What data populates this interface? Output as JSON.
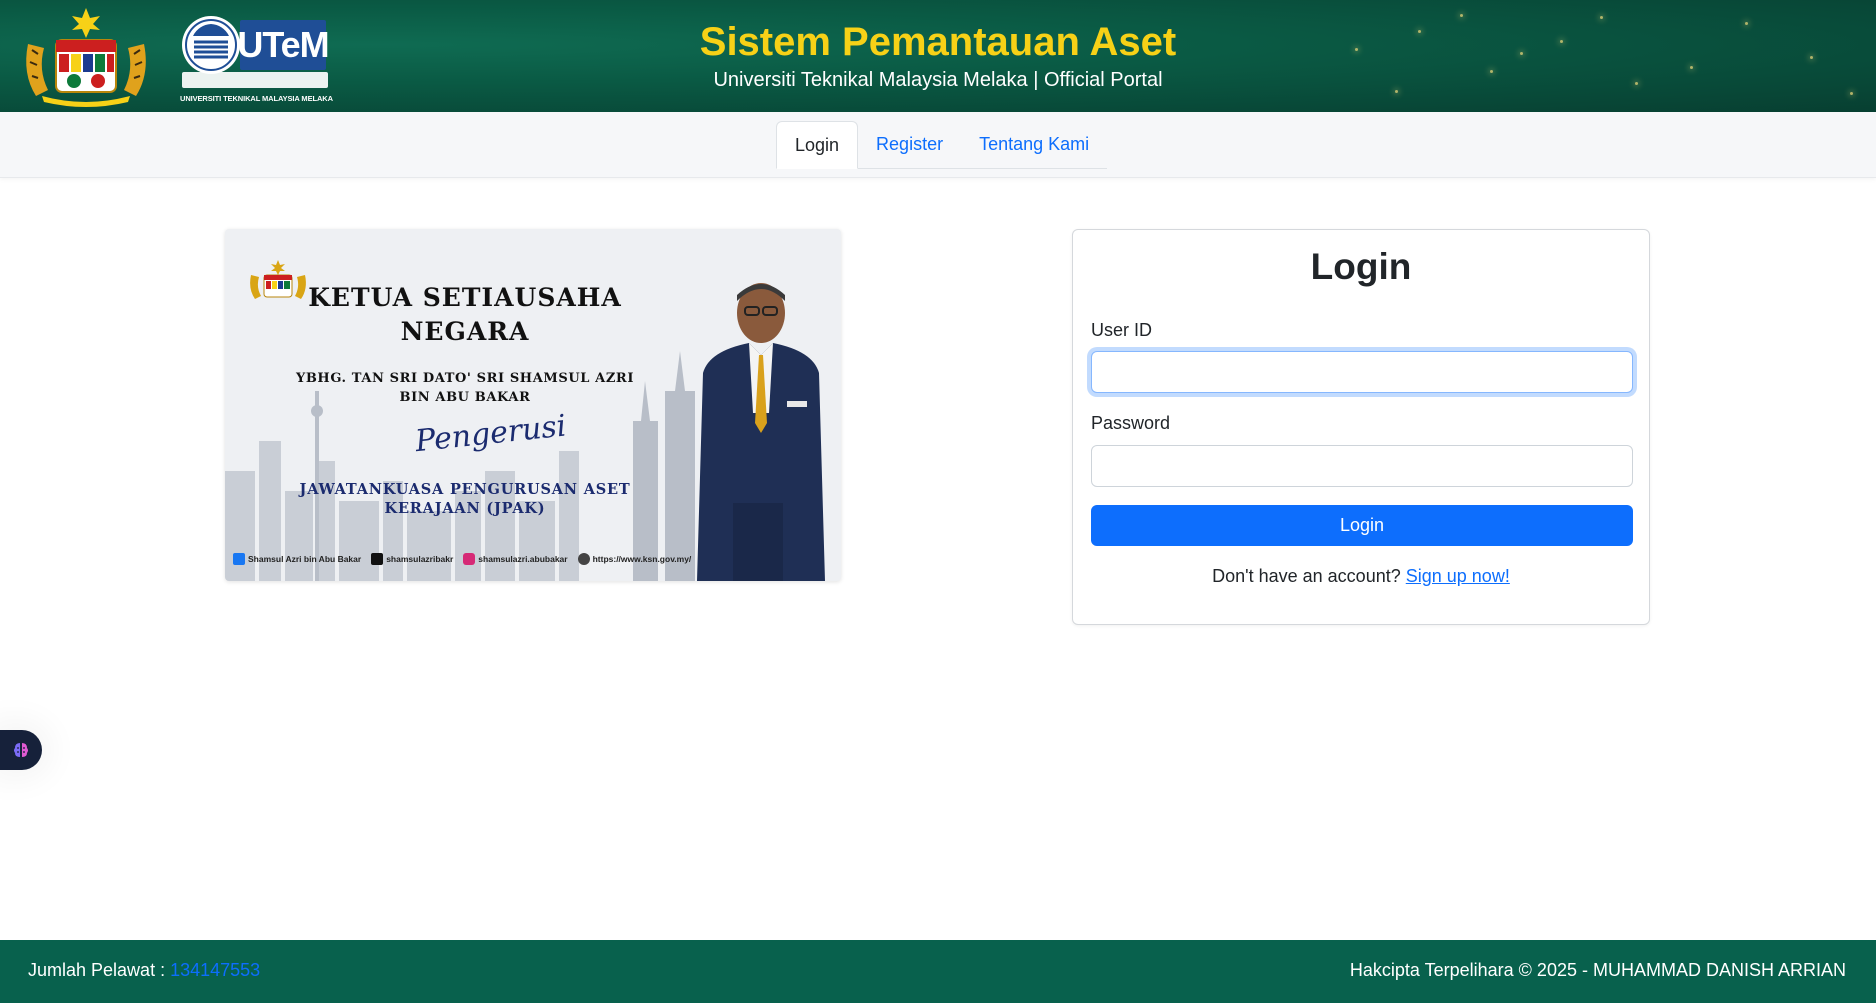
{
  "header": {
    "title": "Sistem Pemantauan Aset",
    "subtitle": "Universiti Teknikal Malaysia Melaka | Official Portal",
    "logos": {
      "coat_of_arms": "malaysia-coat-of-arms-icon",
      "utem_wordmark": "UTeM",
      "utem_caption": "UNIVERSITI TEKNIKAL MALAYSIA MELAKA"
    }
  },
  "nav": {
    "tabs": [
      {
        "label": "Login",
        "active": true
      },
      {
        "label": "Register",
        "active": false
      },
      {
        "label": "Tentang Kami",
        "active": false
      }
    ]
  },
  "banner": {
    "heading_line1": "KETUA SETIAUSAHA",
    "heading_line2": "NEGARA",
    "name_line1": "YBHG. TAN SRI DATO' SRI SHAMSUL AZRI",
    "name_line2": "BIN ABU BAKAR",
    "role_script": "Pengerusi",
    "committee_line1": "JAWATANKUASA PENGURUSAN ASET",
    "committee_line2": "KERAJAAN (JPAK)",
    "social": [
      {
        "icon": "facebook-icon",
        "label": "Shamsul Azri bin Abu Bakar",
        "color": "#1877f2"
      },
      {
        "icon": "x-icon",
        "label": "shamsulazribakr",
        "color": "#111111"
      },
      {
        "icon": "instagram-icon",
        "label": "shamsulazri.abubakar",
        "color": "#d62976"
      },
      {
        "icon": "globe-icon",
        "label": "https://www.ksn.gov.my/",
        "color": "#444444"
      }
    ]
  },
  "login": {
    "title": "Login",
    "user_id_label": "User ID",
    "user_id_value": "",
    "password_label": "Password",
    "password_value": "",
    "submit_label": "Login",
    "signup_prompt": "Don't have an account?",
    "signup_link": "Sign up now!"
  },
  "footer": {
    "visitor_label": "Jumlah Pelawat :",
    "visitor_count": "134147553",
    "copyright": "Hakcipta Terpelihara © 2025 - MUHAMMAD DANISH ARRIAN"
  },
  "colors": {
    "header_green": "#0a5a44",
    "title_gold": "#f7d117",
    "primary_blue": "#0d6efd",
    "footer_green": "#08614d"
  }
}
